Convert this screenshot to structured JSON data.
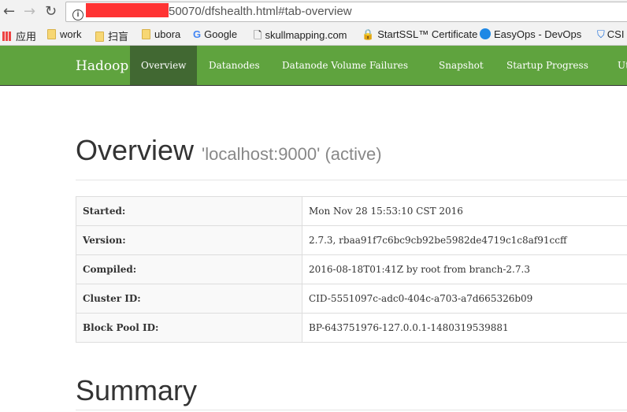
{
  "browser": {
    "url": "50070/dfshealth.html#tab-overview",
    "bookmarks": [
      "应用",
      "work",
      "扫盲",
      "ubora",
      "Google",
      "skullmapping.com",
      "StartSSL™ Certificate",
      "EasyOps - DevOps",
      "CSI"
    ]
  },
  "navbar": {
    "brand": "Hadoop",
    "tabs": [
      "Overview",
      "Datanodes",
      "Datanode Volume Failures",
      "Snapshot",
      "Startup Progress",
      "Ut"
    ]
  },
  "overview": {
    "title": "Overview",
    "subtitle": "'localhost:9000' (active)",
    "rows": [
      {
        "k": "Started:",
        "v": "Mon Nov 28 15:53:10 CST 2016"
      },
      {
        "k": "Version:",
        "v": "2.7.3, rbaa91f7c6bc9cb92be5982de4719c1c8af91ccff"
      },
      {
        "k": "Compiled:",
        "v": "2016-08-18T01:41Z by root from branch-2.7.3"
      },
      {
        "k": "Cluster ID:",
        "v": "CID-5551097c-adc0-404c-a703-a7d665326b09"
      },
      {
        "k": "Block Pool ID:",
        "v": "BP-643751976-127.0.0.1-1480319539881"
      }
    ]
  },
  "summary": {
    "title": "Summary"
  }
}
